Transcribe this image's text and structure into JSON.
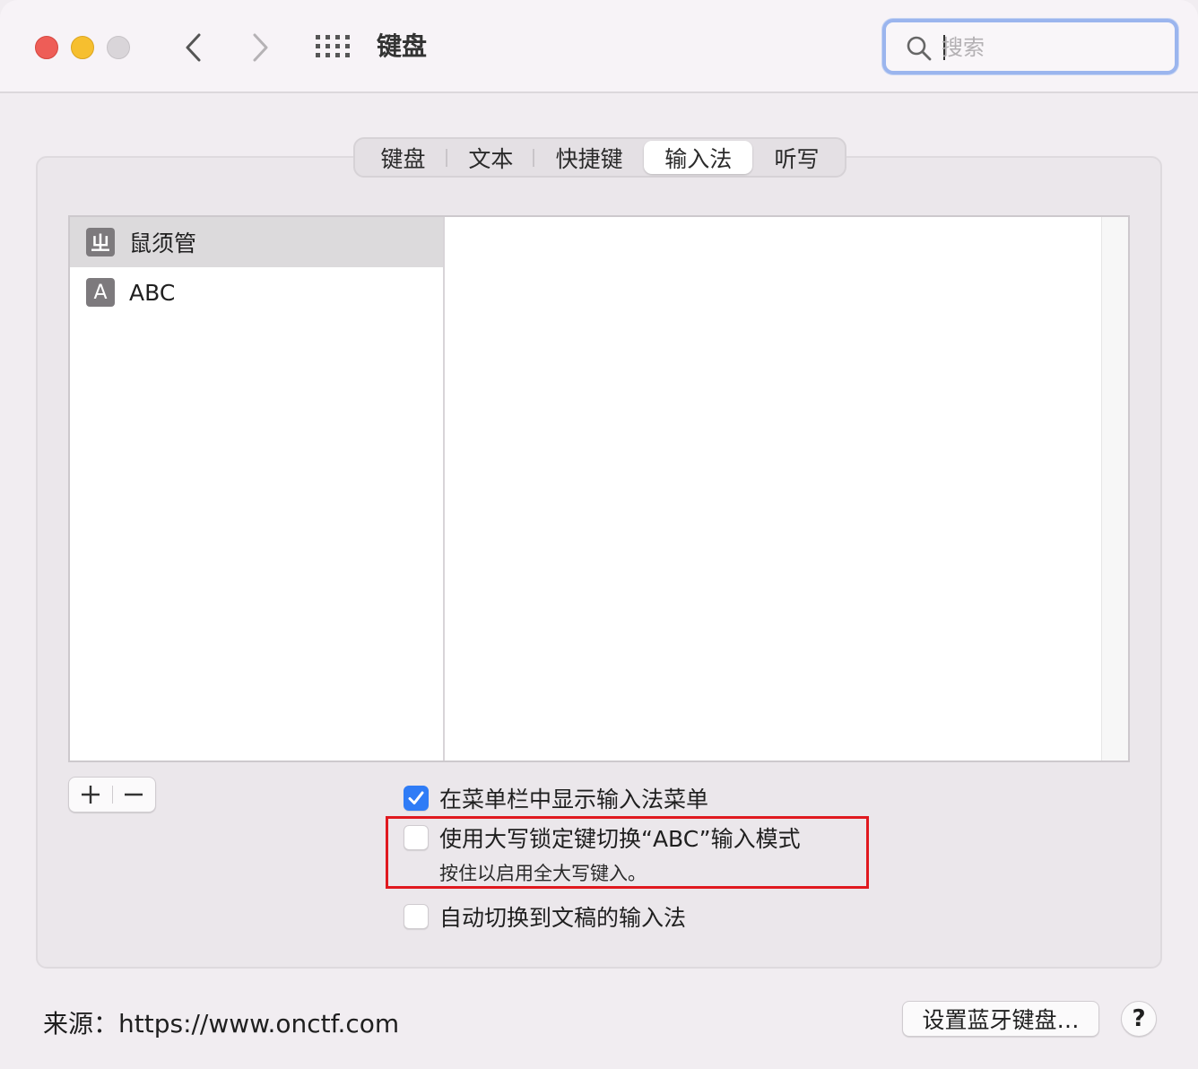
{
  "window": {
    "title": "键盘"
  },
  "search": {
    "placeholder": "搜索",
    "value": ""
  },
  "tabs": [
    {
      "label": "键盘",
      "active": false
    },
    {
      "label": "文本",
      "active": false
    },
    {
      "label": "快捷键",
      "active": false
    },
    {
      "label": "输入法",
      "active": true
    },
    {
      "label": "听写",
      "active": false
    }
  ],
  "input_sources": [
    {
      "badge": "ㄓ",
      "label": "鼠须管",
      "selected": true
    },
    {
      "badge": "A",
      "label": "ABC",
      "selected": false
    }
  ],
  "options": {
    "show_menu": {
      "label": "在菜单栏中显示输入法菜单",
      "checked": true
    },
    "caps_lock": {
      "label": "使用大写锁定键切换“ABC”输入模式",
      "checked": false,
      "sub": "按住以启用全大写键入。"
    },
    "auto_switch": {
      "label": "自动切换到文稿的输入法",
      "checked": false
    }
  },
  "footer": {
    "source_text": "来源：https://www.onctf.com",
    "bluetooth_button": "设置蓝牙键盘…",
    "help_button": "?"
  },
  "colors": {
    "accent": "#2f7cf6",
    "highlight_box": "#e0191f",
    "close": "#ee5d57",
    "minimize": "#f6bf2f"
  }
}
